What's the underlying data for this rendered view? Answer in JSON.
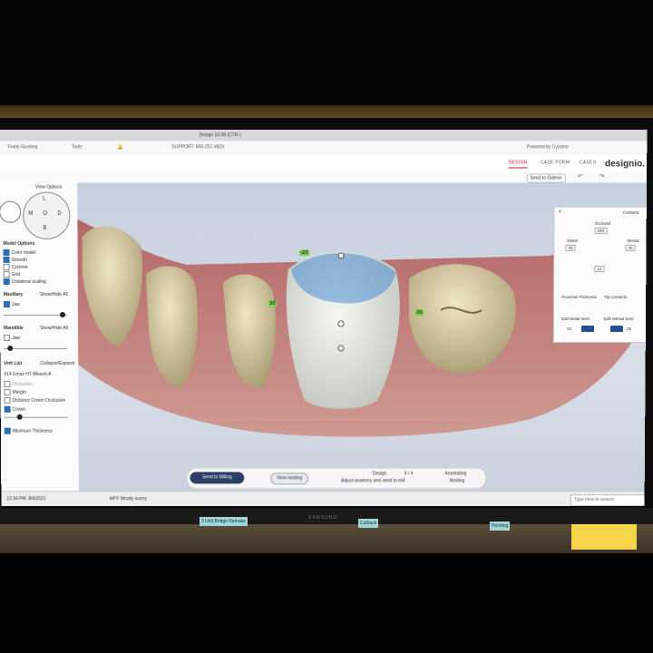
{
  "header": {
    "powered_by": "Powered by Cyclone",
    "support": "SUPPORT: 866-257-4829",
    "tools": "Tools",
    "user": "Frank Gucking",
    "title_strip": "Design 10:38 (CTR-)"
  },
  "nav": {
    "tabs": [
      "DESIGN",
      "CASE FORM",
      "CASES"
    ],
    "active": "DESIGN",
    "logo": "designio."
  },
  "toolbar": {
    "send_label": "Send to Gideon"
  },
  "left_panel": {
    "view_options": "View Options",
    "dpad": {
      "top": "L",
      "left": "M",
      "center": "O",
      "right": "D",
      "bottom": "B"
    },
    "model_options": "Model Options",
    "options": [
      {
        "label": "Color model",
        "checked": true
      },
      {
        "label": "Smooth",
        "checked": true
      },
      {
        "label": "Cyclone",
        "checked": false
      },
      {
        "label": "Grid",
        "checked": false
      },
      {
        "label": "Unilateral scaling",
        "checked": true
      }
    ],
    "maxillary": "Maxillary",
    "maxillary_jaw": "Jaw",
    "mandible": "Mandible",
    "mandible_jaw": "Jaw",
    "show_hide": "Show/Hide All",
    "unit_list": "Unit List",
    "collapse": "Collapse/Expand",
    "tooth": "#14 Emax HT-Bleach-A",
    "options2": [
      {
        "label": "Occlusion",
        "checked": false
      },
      {
        "label": "Margin",
        "checked": false
      },
      {
        "label": "Distance Crown Occlusion",
        "checked": false
      },
      {
        "label": "Crown",
        "checked": false
      },
      {
        "label": "Minimum Thickness",
        "checked": true
      }
    ]
  },
  "right_panel": {
    "title": "Contacts",
    "occlusal": "Occlusal",
    "occlusal_val": "250",
    "mesial": "Mesial",
    "mesial_val": "30",
    "distal": "Distal",
    "distal_val": "30",
    "bottom_val": "14",
    "proximal": "Proximal Thickness",
    "tip_contacts": "Tip Contacts",
    "edit_distal": "Edit Distal Sent",
    "edit_mesial": "Edit Mesial Sent",
    "nums": [
      "13",
      "15"
    ]
  },
  "viewport": {
    "labels": [
      "-20",
      "30",
      "30"
    ],
    "scan_palette": {
      "gum": "#c07a78",
      "tooth": "#d8cfae",
      "crown": "#e8ebe6",
      "adjust": "#4a8fd4"
    }
  },
  "bottom_bar": {
    "mill_label": "Send to Milling",
    "view_label": "View nesting",
    "step1_title": "Design",
    "step1_desc": "Adjust anatomy and send to mill",
    "step1_num": "4 / 4",
    "step2_title": "Annotating",
    "step2_desc": "Nesting"
  },
  "taskbar": {
    "search": "Type here to search",
    "weather": "84°F Mostly sunny",
    "time": "12:34 PM",
    "date": "8/4/2021"
  },
  "bezel": {
    "brand": "SAMSUNG"
  },
  "desk_notes": [
    "Cutback",
    "3 Unit Bridge Remake",
    "Pending"
  ]
}
